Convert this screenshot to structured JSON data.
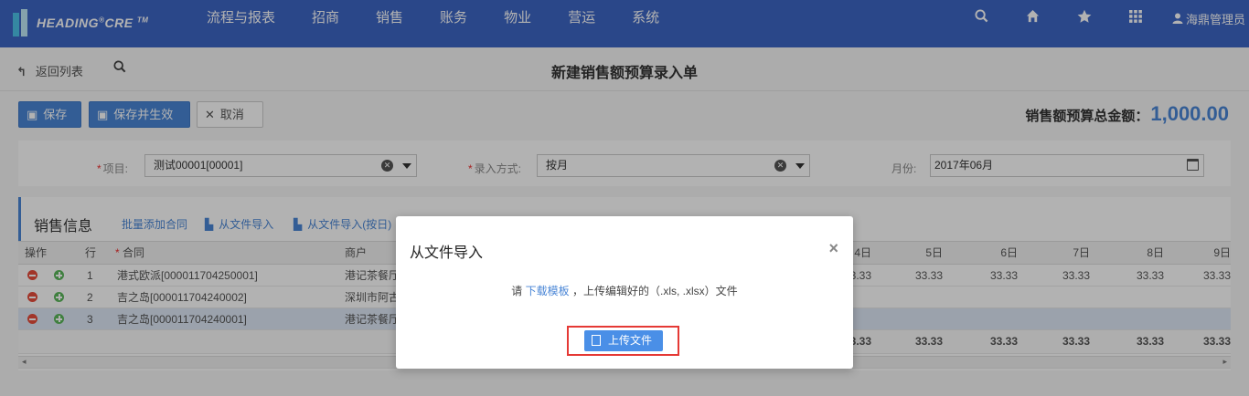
{
  "brand": {
    "name": "HEADING",
    "reg": "®",
    "name2": "CRE",
    "tm": "TM"
  },
  "nav": {
    "items": [
      "流程与报表",
      "招商",
      "销售",
      "账务",
      "物业",
      "营运",
      "系统"
    ],
    "user": "海鼎管理员",
    "icons": [
      "search-icon",
      "home-icon",
      "star-icon",
      "apps-grid-icon",
      "user-icon"
    ]
  },
  "page": {
    "back_label": "返回列表",
    "title": "新建销售额预算录入单",
    "buttons": {
      "save": "保存",
      "save_effective": "保存并生效",
      "cancel": "取消"
    },
    "total_label": "销售额预算总金额：",
    "total_value": "1,000.00"
  },
  "filters": {
    "project_label": "项目:",
    "project_value": "测试00001[00001]",
    "entry_label": "录入方式:",
    "entry_value": "按月",
    "month_label": "月份:",
    "month_value": "2017年06月"
  },
  "panel": {
    "title": "销售信息",
    "links": [
      "批量添加合同",
      "从文件导入",
      "从文件导入(按日)"
    ]
  },
  "grid": {
    "headers": {
      "op": "操作",
      "row": "行",
      "contract": "合同",
      "tenant": "商户"
    },
    "day_headers": [
      "4日",
      "5日",
      "6日",
      "7日",
      "8日",
      "9日"
    ],
    "rows": [
      {
        "n": "1",
        "contract": "港式欧派[000011704250001]",
        "tenant": "港记茶餐厅",
        "days": [
          "33.33",
          "33.33",
          "33.33",
          "33.33",
          "33.33",
          "33.33"
        ]
      },
      {
        "n": "2",
        "contract": "吉之岛[000011704240002]",
        "tenant": "深圳市阿古",
        "days": [
          "",
          "",
          "",
          "",
          "",
          ""
        ]
      },
      {
        "n": "3",
        "contract": "吉之岛[000011704240001]",
        "tenant": "港记茶餐厅",
        "days": [
          "",
          "",
          "",
          "",
          "",
          ""
        ]
      }
    ],
    "totals": [
      "33.33",
      "33.33",
      "33.33",
      "33.33",
      "33.33",
      "33.33"
    ]
  },
  "modal": {
    "title": "从文件导入",
    "msg_prefix": "请",
    "msg_link": "下载模板",
    "msg_suffix": "，上传编辑好的（.xls, .xlsx）文件",
    "upload_label": "上传文件"
  }
}
